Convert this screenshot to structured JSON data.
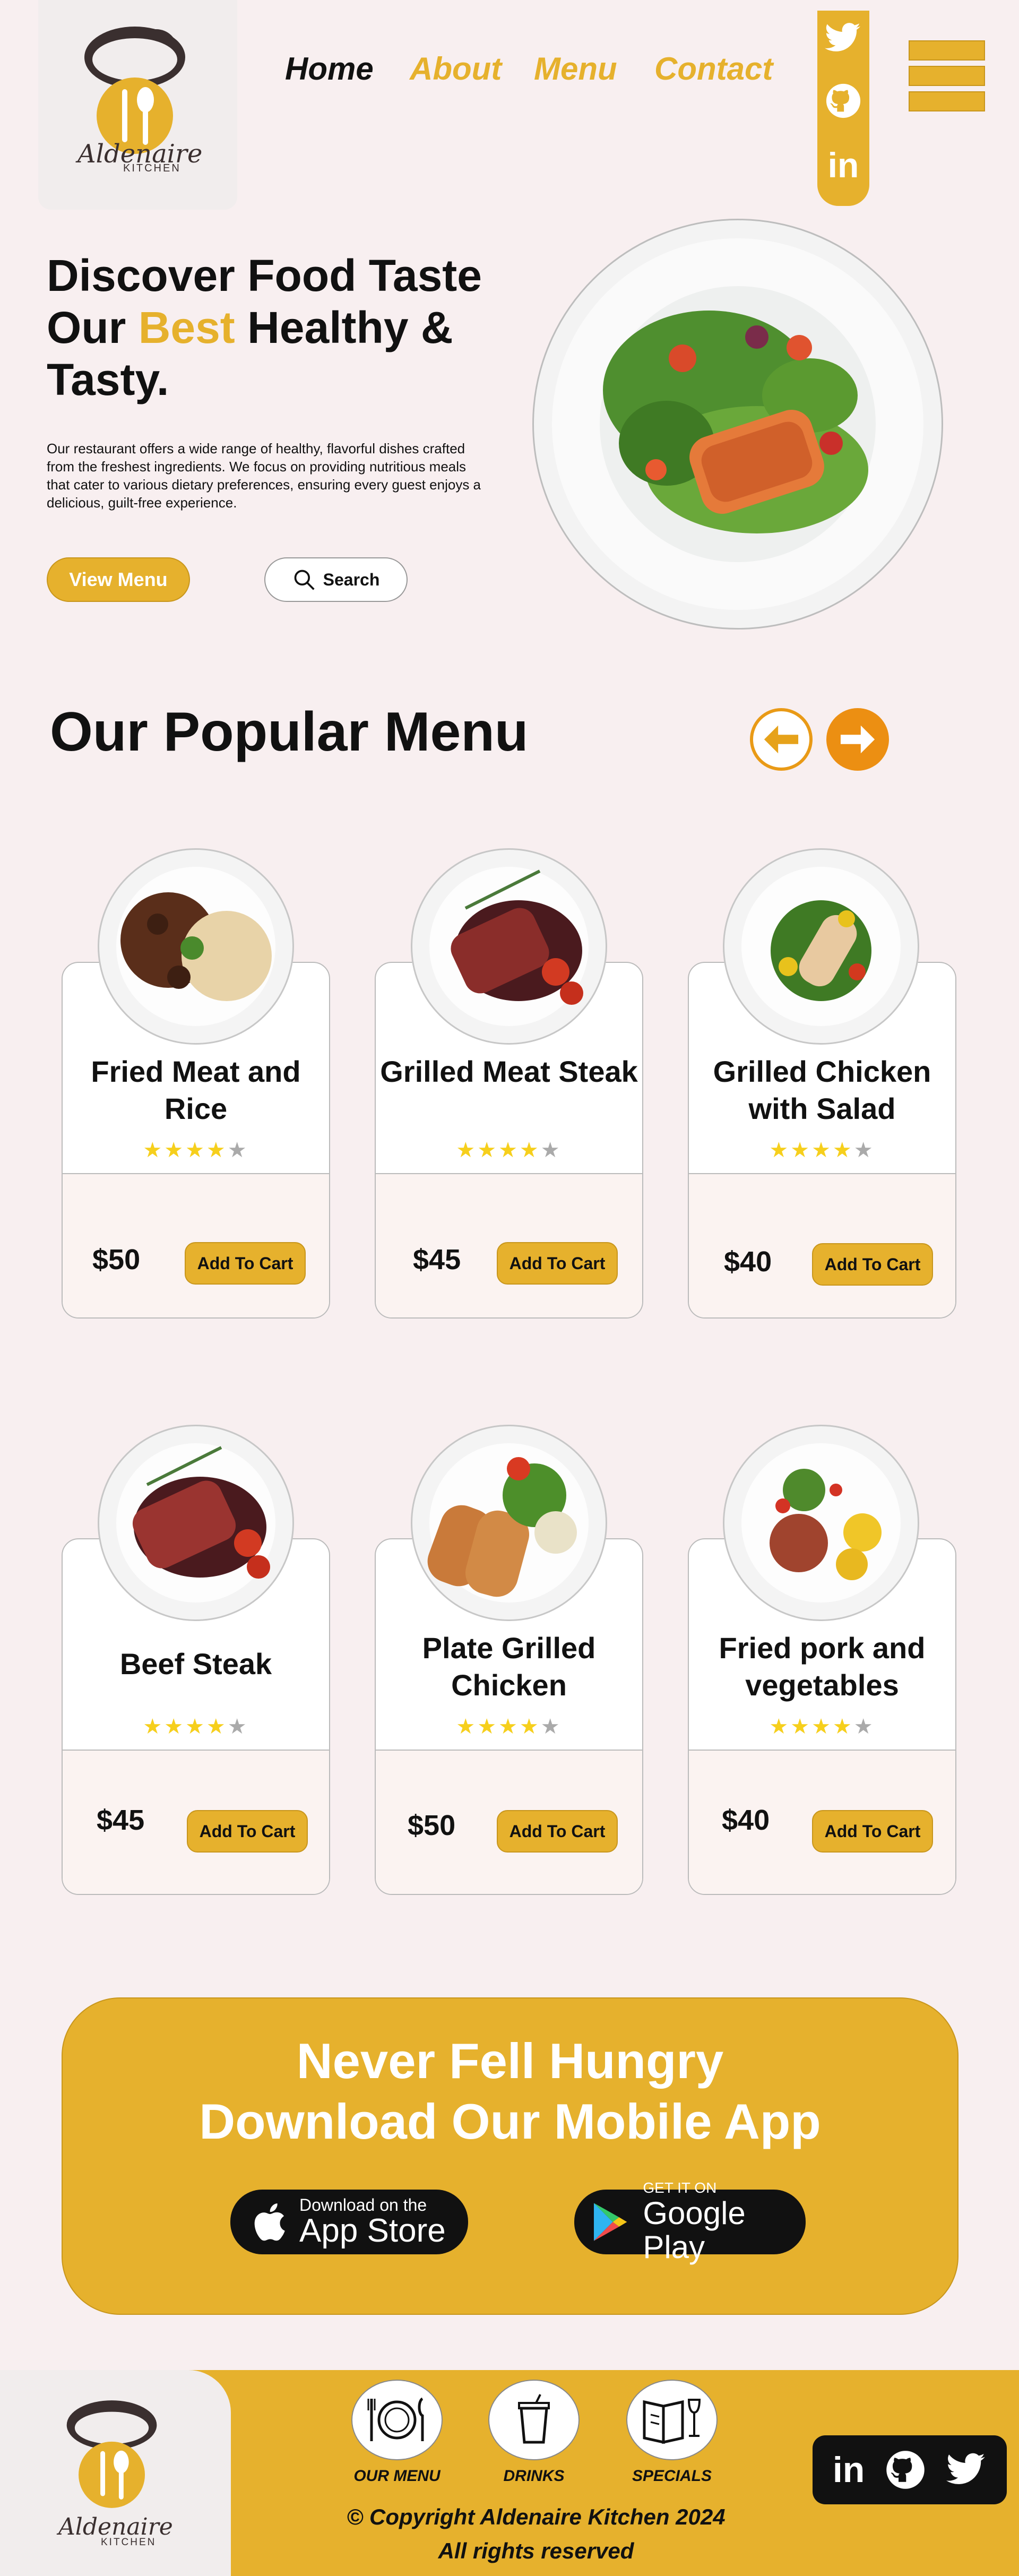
{
  "brand": {
    "name": "Aldenaire",
    "sub": "KITCHEN",
    "accent": "#e6b12d"
  },
  "nav": {
    "home": "Home",
    "about": "About",
    "menu": "Menu",
    "contact": "Contact"
  },
  "hero": {
    "title_line1": "Discover Food Taste",
    "title_our": "Our ",
    "title_best": "Best",
    "title_rest": " Healthy &",
    "title_line3": "Tasty.",
    "description": "Our restaurant offers a wide range of healthy, flavorful dishes crafted from the freshest ingredients. We focus on providing nutritious meals that cater to various dietary preferences, ensuring every guest enjoys a delicious, guilt-free experience.",
    "view_menu": "View Menu",
    "search": "Search"
  },
  "popular": {
    "title": "Our Popular Menu",
    "items": [
      {
        "name": "Fried Meat and Rice",
        "price": "$50",
        "rating": 4,
        "cart": "Add To Cart"
      },
      {
        "name": "Grilled Meat Steak",
        "price": "$45",
        "rating": 4,
        "cart": "Add To Cart"
      },
      {
        "name": "Grilled Chicken with Salad",
        "price": "$40",
        "rating": 4,
        "cart": "Add To Cart"
      },
      {
        "name": "Beef Steak",
        "price": "$45",
        "rating": 4,
        "cart": "Add To Cart"
      },
      {
        "name": "Plate Grilled Chicken",
        "price": "$50",
        "rating": 4,
        "cart": "Add To Cart"
      },
      {
        "name": "Fried pork and vegetables",
        "price": "$40",
        "rating": 4,
        "cart": "Add To Cart"
      }
    ]
  },
  "app": {
    "line1": "Never Fell Hungry",
    "line2": "Download Our Mobile App",
    "appstore_small": "Download on the",
    "appstore_big": "App Store",
    "play_small": "GET IT ON",
    "play_big": "Google Play"
  },
  "footer": {
    "links": [
      "OUR MENU",
      "DRINKS",
      "SPECIALS"
    ],
    "copyright": "© Copyright Aldenaire Kitchen 2024",
    "rights": "All rights reserved"
  }
}
